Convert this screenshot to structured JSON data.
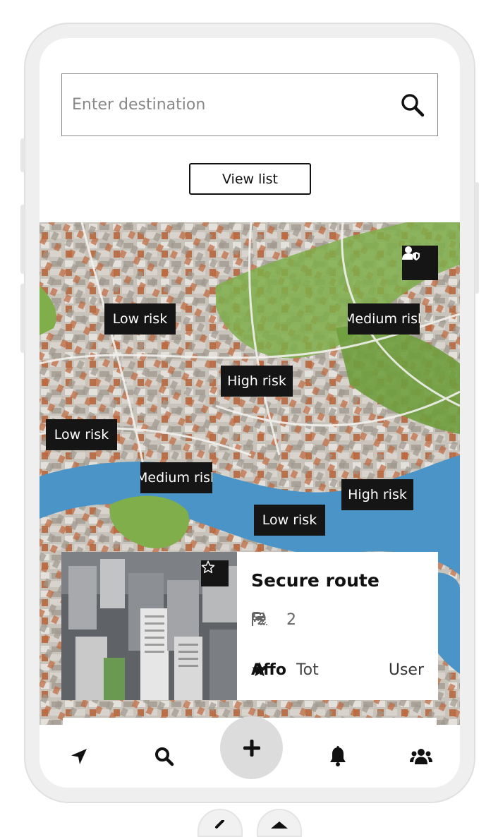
{
  "search": {
    "placeholder": "Enter destination",
    "icon": "search-icon"
  },
  "view_list_label": "View list",
  "map": {
    "location_button_icon": "user-shield-icon",
    "risk_labels": [
      {
        "label": "Low risk",
        "level": "low"
      },
      {
        "label": "Medium risk",
        "level": "medium"
      },
      {
        "label": "High risk",
        "level": "high"
      },
      {
        "label": "Low risk",
        "level": "low"
      },
      {
        "label": "Medium risk",
        "level": "medium"
      },
      {
        "label": "High risk",
        "level": "high"
      },
      {
        "label": "Low risk",
        "level": "low"
      }
    ]
  },
  "card": {
    "title": "Secure route",
    "features": [
      {
        "icon": "car-icon",
        "value": "2"
      },
      {
        "icon": "shower-icon",
        "value": "2"
      }
    ],
    "tag1": "Affo",
    "tag2": "Tot",
    "user_label": "User",
    "user_icon": "star-icon",
    "favorite_icon": "star-outline-icon"
  },
  "navbar": {
    "items": [
      {
        "name": "navigate",
        "icon": "location-arrow-icon"
      },
      {
        "name": "search",
        "icon": "search-icon"
      },
      {
        "name": "add",
        "icon": "plus-icon"
      },
      {
        "name": "notifications",
        "icon": "bell-icon"
      },
      {
        "name": "community",
        "icon": "users-icon"
      }
    ]
  },
  "colors": {
    "label_bg": "#151515",
    "fab_bg": "#dcdcdc",
    "water": "#4a94c8",
    "park": "#7fae4a"
  }
}
